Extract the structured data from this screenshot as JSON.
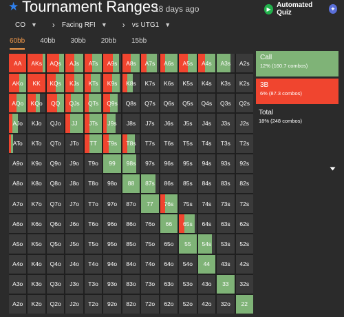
{
  "header": {
    "star_icon": "star-icon",
    "title": "Tournament Ranges",
    "age": "18 days ago",
    "quiz_label": "Automated Quiz",
    "colors": {
      "accent": "#2f80ed",
      "quiz": "#22b14c"
    }
  },
  "breadcrumbs": [
    {
      "label": "CO",
      "has_dropdown": true
    },
    {
      "label": "Facing RFI",
      "has_dropdown": true
    },
    {
      "label": "vs UTG1",
      "has_dropdown": true
    }
  ],
  "tabs": [
    {
      "label": "60bb",
      "active": true
    },
    {
      "label": "40bb",
      "active": false
    },
    {
      "label": "30bb",
      "active": false
    },
    {
      "label": "20bb",
      "active": false
    },
    {
      "label": "15bb",
      "active": false
    }
  ],
  "legend": {
    "call": {
      "name": "Call",
      "sub": "12% (160.7 combos)",
      "color": "#7fb377"
    },
    "raise": {
      "name": "3B",
      "sub": "6% (87.3 combos)",
      "color": "#f0452f"
    },
    "total": {
      "name": "Total",
      "sub": "18% (248 combos)"
    }
  },
  "grid": [
    [
      "AA",
      "AKs",
      "AQs",
      "AJs",
      "ATs",
      "A9s",
      "A8s",
      "A7s",
      "A6s",
      "A5s",
      "A4s",
      "A3s",
      "A2s"
    ],
    [
      "AKo",
      "KK",
      "KQs",
      "KJs",
      "KTs",
      "K9s",
      "K8s",
      "K7s",
      "K6s",
      "K5s",
      "K4s",
      "K3s",
      "K2s"
    ],
    [
      "AQo",
      "KQo",
      "QQ",
      "QJs",
      "QTs",
      "Q9s",
      "Q8s",
      "Q7s",
      "Q6s",
      "Q5s",
      "Q4s",
      "Q3s",
      "Q2s"
    ],
    [
      "AJo",
      "KJo",
      "QJo",
      "JJ",
      "JTs",
      "J9s",
      "J8s",
      "J7s",
      "J6s",
      "J5s",
      "J4s",
      "J3s",
      "J2s"
    ],
    [
      "ATo",
      "KTo",
      "QTo",
      "JTo",
      "TT",
      "T9s",
      "T8s",
      "T7s",
      "T6s",
      "T5s",
      "T4s",
      "T3s",
      "T2s"
    ],
    [
      "A9o",
      "K9o",
      "Q9o",
      "J9o",
      "T9o",
      "99",
      "98s",
      "97s",
      "96s",
      "95s",
      "94s",
      "93s",
      "92s"
    ],
    [
      "A8o",
      "K8o",
      "Q8o",
      "J8o",
      "T8o",
      "98o",
      "88",
      "87s",
      "86s",
      "85s",
      "84s",
      "83s",
      "82s"
    ],
    [
      "A7o",
      "K7o",
      "Q7o",
      "J7o",
      "T7o",
      "97o",
      "87o",
      "77",
      "76s",
      "75s",
      "74s",
      "73s",
      "72s"
    ],
    [
      "A6o",
      "K6o",
      "Q6o",
      "J6o",
      "T6o",
      "96o",
      "86o",
      "76o",
      "66",
      "65s",
      "64s",
      "63s",
      "62s"
    ],
    [
      "A5o",
      "K5o",
      "Q5o",
      "J5o",
      "T5o",
      "95o",
      "85o",
      "75o",
      "65o",
      "55",
      "54s",
      "53s",
      "52s"
    ],
    [
      "A4o",
      "K4o",
      "Q4o",
      "J4o",
      "T4o",
      "94o",
      "84o",
      "74o",
      "64o",
      "54o",
      "44",
      "43s",
      "42s"
    ],
    [
      "A3o",
      "K3o",
      "Q3o",
      "J3o",
      "T3o",
      "93o",
      "83o",
      "73o",
      "63o",
      "53o",
      "43o",
      "33",
      "32s"
    ],
    [
      "A2o",
      "K2o",
      "Q2o",
      "J2o",
      "T2o",
      "92o",
      "82o",
      "72o",
      "62o",
      "52o",
      "42o",
      "32o",
      "22"
    ]
  ],
  "frequencies": {
    "AA": [
      0,
      1.0
    ],
    "AKs": [
      0.15,
      0.85
    ],
    "AQs": [
      0.3,
      0.7
    ],
    "AJs": [
      0.5,
      0.5
    ],
    "ATs": [
      0.55,
      0.45
    ],
    "A9s": [
      0.35,
      0.55
    ],
    "A8s": [
      0.5,
      0.5
    ],
    "A7s": [
      0.6,
      0.3
    ],
    "A6s": [
      0.7,
      0.3
    ],
    "A5s": [
      0.5,
      0.5
    ],
    "A4s": [
      0.6,
      0.4
    ],
    "A3s": [
      0.8,
      0
    ],
    "A2s": [
      0,
      0
    ],
    "AKo": [
      0.4,
      0.6
    ],
    "KK": [
      0,
      1.0
    ],
    "KQs": [
      0.5,
      0.5
    ],
    "KJs": [
      0.5,
      0.5
    ],
    "KTs": [
      0.55,
      0.35
    ],
    "K9s": [
      0.45,
      0.5
    ],
    "K8s": [
      0.3,
      0.3
    ],
    "AQo": [
      0.55,
      0.45
    ],
    "KQo": [
      0.25,
      0.45
    ],
    "QQ": [
      0.4,
      0.6
    ],
    "QJs": [
      0.7,
      0.3
    ],
    "QTs": [
      0.7,
      0.25
    ],
    "Q9s": [
      0.4,
      0.4
    ],
    "AJo": [
      0.3,
      0.2
    ],
    "JJ": [
      0.75,
      0.25
    ],
    "JTs": [
      0.7,
      0.3
    ],
    "J9s": [
      0.5,
      0.2
    ],
    "ATo": [
      0.15,
      0.1
    ],
    "TT": [
      0.7,
      0.3
    ],
    "T9s": [
      0.7,
      0.3
    ],
    "T8s": [
      0.4,
      0.3
    ],
    "99": [
      1.0,
      0
    ],
    "98s": [
      0.8,
      0
    ],
    "88": [
      1.0,
      0
    ],
    "87s": [
      0.8,
      0
    ],
    "77": [
      1.0,
      0
    ],
    "76s": [
      0.7,
      0.3
    ],
    "66": [
      1.0,
      0
    ],
    "65s": [
      0.6,
      0.3
    ],
    "55": [
      1.0,
      0
    ],
    "54s": [
      0.8,
      0
    ],
    "44": [
      1.0,
      0
    ],
    "33": [
      1.0,
      0
    ],
    "22": [
      1.0,
      0
    ]
  },
  "cursor_icon": "mouse-cursor-icon"
}
